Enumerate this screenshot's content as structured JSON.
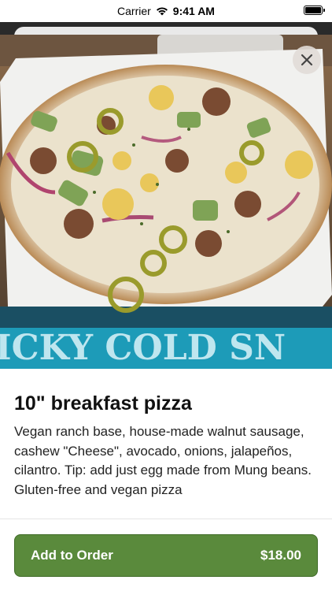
{
  "status_bar": {
    "carrier": "Carrier",
    "time": "9:41 AM"
  },
  "photo": {
    "sign_text": "ICKY  COLD SN"
  },
  "item": {
    "title": "10\" breakfast pizza",
    "description": "Vegan ranch base, house-made walnut sausage, cashew \"Cheese\", avocado, onions, jalapeños, cilantro. Tip: add just egg made from Mung beans. Gluten-free and vegan pizza"
  },
  "order_button": {
    "label": "Add to Order",
    "price": "$18.00"
  },
  "colors": {
    "accent": "#5a8a3c",
    "accent_border": "#3f6b28",
    "sign_blue": "#1d9bb8"
  },
  "icons": {
    "close": "close-icon",
    "wifi": "wifi-icon",
    "battery": "battery-icon"
  }
}
